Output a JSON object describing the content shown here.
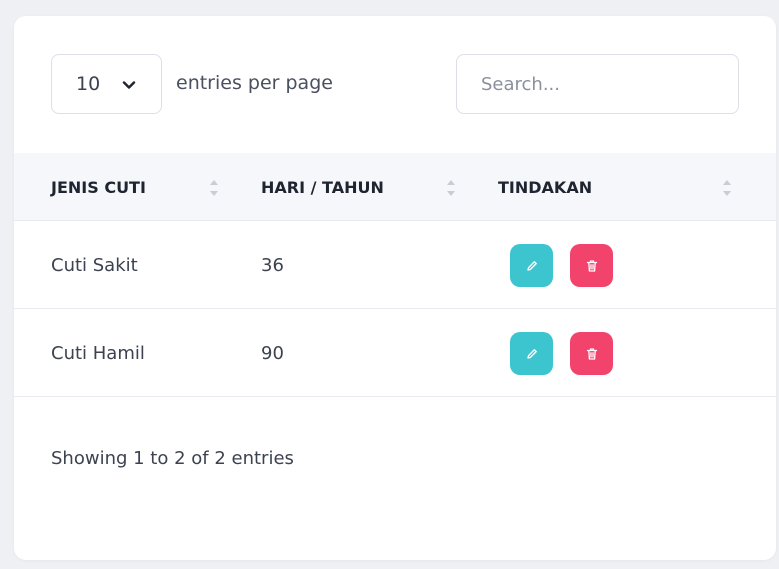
{
  "toolbar": {
    "per_page_value": "10",
    "per_page_label": "entries per page",
    "search_placeholder": "Search..."
  },
  "table": {
    "columns": [
      "JENIS CUTI",
      "HARI / TAHUN",
      "TINDAKAN"
    ],
    "rows": [
      {
        "jenis_cuti": "Cuti Sakit",
        "hari_tahun": "36"
      },
      {
        "jenis_cuti": "Cuti Hamil",
        "hari_tahun": "90"
      }
    ]
  },
  "footer": {
    "info": "Showing 1 to 2 of 2 entries"
  },
  "colors": {
    "edit_button": "#3cc4cf",
    "delete_button": "#f2436d",
    "header_bg": "#f5f7fa"
  },
  "icons": {
    "select_chevron": "chevron-down-icon",
    "sort": "sort-icon",
    "edit": "pencil-icon",
    "delete": "trash-icon"
  }
}
